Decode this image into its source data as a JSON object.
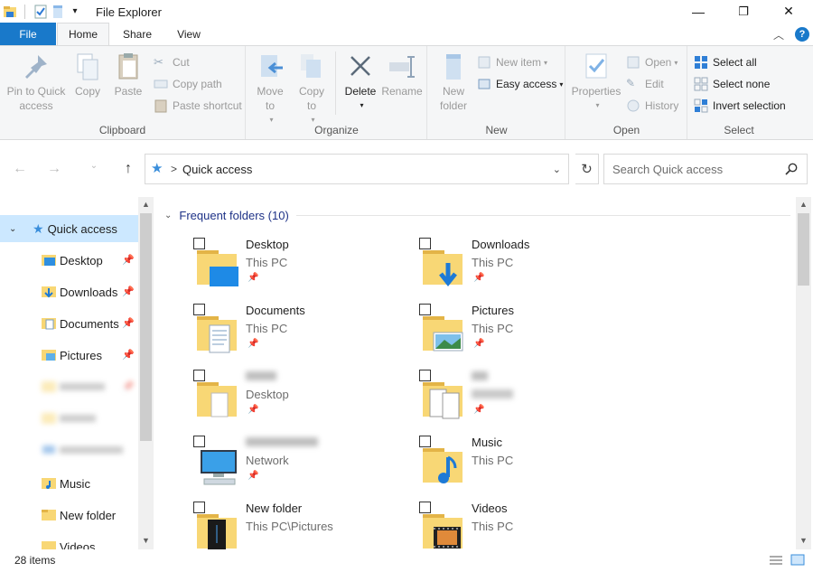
{
  "window": {
    "title": "File Explorer",
    "controls": {
      "minimize": "—",
      "restore": "❐",
      "close": "✕"
    }
  },
  "tabs": {
    "file": "File",
    "home": "Home",
    "share": "Share",
    "view": "View",
    "help": "?"
  },
  "ribbon": {
    "clipboard": {
      "label": "Clipboard",
      "pin_to_quick_access": "Pin to Quick access",
      "copy": "Copy",
      "paste": "Paste",
      "cut": "Cut",
      "copy_path": "Copy path",
      "paste_shortcut": "Paste shortcut"
    },
    "organize": {
      "label": "Organize",
      "move_to": "Move to",
      "copy_to": "Copy to",
      "delete": "Delete",
      "rename": "Rename"
    },
    "new": {
      "label": "New",
      "new_folder": "New folder",
      "new_item": "New item",
      "easy_access": "Easy access"
    },
    "open": {
      "label": "Open",
      "properties": "Properties",
      "open": "Open",
      "edit": "Edit",
      "history": "History"
    },
    "select": {
      "label": "Select",
      "select_all": "Select all",
      "select_none": "Select none",
      "invert_selection": "Invert selection"
    }
  },
  "address": {
    "path": "Quick access",
    "search_placeholder": "Search Quick access"
  },
  "nav": {
    "quick_access": "Quick access",
    "items": [
      {
        "label": "Desktop",
        "pinned": true
      },
      {
        "label": "Downloads",
        "pinned": true
      },
      {
        "label": "Documents",
        "pinned": true
      },
      {
        "label": "Pictures",
        "pinned": true
      },
      {
        "label": "",
        "pinned": true
      },
      {
        "label": "",
        "pinned": false
      },
      {
        "label": "",
        "pinned": false
      },
      {
        "label": "Music",
        "pinned": false
      },
      {
        "label": "New folder",
        "pinned": false
      },
      {
        "label": "Videos",
        "pinned": false
      }
    ]
  },
  "content": {
    "group_title": "Frequent folders (10)",
    "tiles": [
      {
        "name": "Desktop",
        "location": "This PC"
      },
      {
        "name": "Downloads",
        "location": "This PC"
      },
      {
        "name": "Documents",
        "location": "This PC"
      },
      {
        "name": "Pictures",
        "location": "This PC"
      },
      {
        "name": "",
        "location": "Desktop"
      },
      {
        "name": "",
        "location": ""
      },
      {
        "name": "",
        "location": "Network"
      },
      {
        "name": "Music",
        "location": "This PC"
      },
      {
        "name": "New folder",
        "location": "This PC\\Pictures"
      },
      {
        "name": "Videos",
        "location": "This PC"
      }
    ]
  },
  "status": {
    "items_count": "28 items"
  },
  "colors": {
    "accent": "#1979ca",
    "selected": "#cce8ff",
    "folder": "#f8d775",
    "header_text": "#1e3287"
  }
}
